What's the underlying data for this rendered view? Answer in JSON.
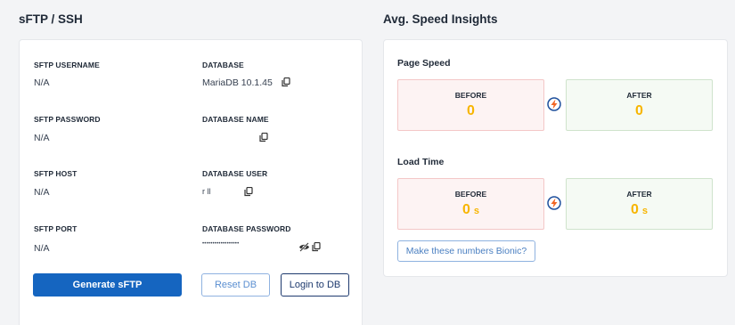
{
  "sftp_section": {
    "title": "sFTP / SSH",
    "fields": {
      "sftp_username": {
        "label": "SFTP USERNAME",
        "value": "N/A"
      },
      "database": {
        "label": "DATABASE",
        "value": "MariaDB 10.1.45"
      },
      "sftp_password": {
        "label": "SFTP PASSWORD",
        "value": "N/A"
      },
      "database_name": {
        "label": "DATABASE NAME",
        "value": ""
      },
      "sftp_host": {
        "label": "SFTP HOST",
        "value": "N/A"
      },
      "database_user": {
        "label": "DATABASE USER",
        "value": "r    ll"
      },
      "sftp_port": {
        "label": "SFTP PORT",
        "value": "N/A"
      },
      "database_password": {
        "label": "DATABASE PASSWORD",
        "value": "••••••••••••••••••"
      }
    },
    "buttons": {
      "generate": "Generate sFTP",
      "reset_db": "Reset DB",
      "login_db": "Login to DB"
    }
  },
  "speed_section": {
    "title": "Avg. Speed Insights",
    "page_speed": {
      "title": "Page Speed",
      "before_label": "BEFORE",
      "before_value": "0",
      "after_label": "AFTER",
      "after_value": "0"
    },
    "load_time": {
      "title": "Load Time",
      "before_label": "BEFORE",
      "before_value": "0",
      "before_unit": "s",
      "after_label": "AFTER",
      "after_value": "0",
      "after_unit": "s"
    },
    "bionic_button": "Make these numbers Bionic?"
  },
  "colors": {
    "primary": "#1565c0",
    "metric_value": "#f7b500",
    "before_bg": "#fdf3f3",
    "after_bg": "#f5faf4",
    "bolt_orange": "#f26522",
    "bolt_ring": "#1e4f9c"
  },
  "icons": {
    "copy": "copy-icon",
    "eye_off": "eye-off-icon",
    "bolt": "bolt-icon"
  }
}
